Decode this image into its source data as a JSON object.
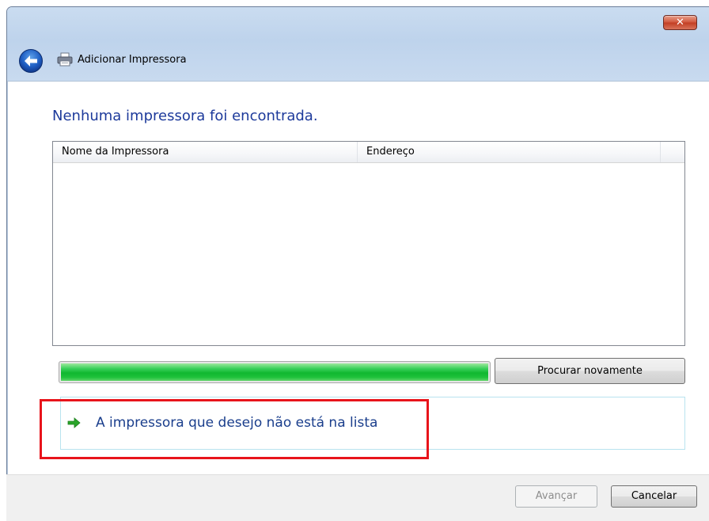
{
  "window": {
    "title": "Adicionar Impressora",
    "close_label": "✕"
  },
  "content": {
    "heading": "Nenhuma impressora foi encontrada."
  },
  "list": {
    "columns": [
      "Nome da Impressora",
      "Endereço"
    ],
    "rows": []
  },
  "search": {
    "progress_percent": 100,
    "search_again_label": "Procurar novamente"
  },
  "link": {
    "text": "A impressora que desejo não está na lista"
  },
  "footer": {
    "next_label": "Avançar",
    "cancel_label": "Cancelar"
  },
  "colors": {
    "heading": "#1d3a9b",
    "link": "#1a3e8c",
    "highlight_border": "#e8141b",
    "progress_green": "#10b830"
  },
  "icons": {
    "back": "back-arrow-icon",
    "printer": "printer-icon",
    "link_arrow": "green-arrow-icon",
    "close": "close-icon"
  }
}
